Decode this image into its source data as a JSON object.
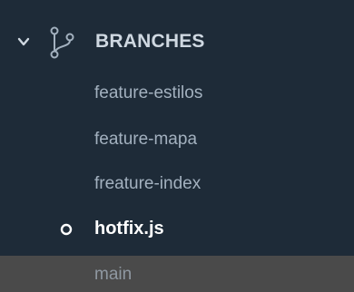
{
  "section": {
    "title": "BRANCHES",
    "expanded_icon": "chevron-down-icon",
    "icon": "git-branch-icon"
  },
  "branches": [
    {
      "name": "feature-estilos",
      "current": false
    },
    {
      "name": "feature-mapa",
      "current": false
    },
    {
      "name": "freature-index",
      "current": false
    },
    {
      "name": "hotfix.js",
      "current": true
    },
    {
      "name": "main",
      "current": false,
      "highlighted": true
    }
  ],
  "colors": {
    "background": "#1e2b38",
    "text": "#a3b1bf",
    "current_text": "#ffffff",
    "highlight_row": "#4a4a4a"
  }
}
